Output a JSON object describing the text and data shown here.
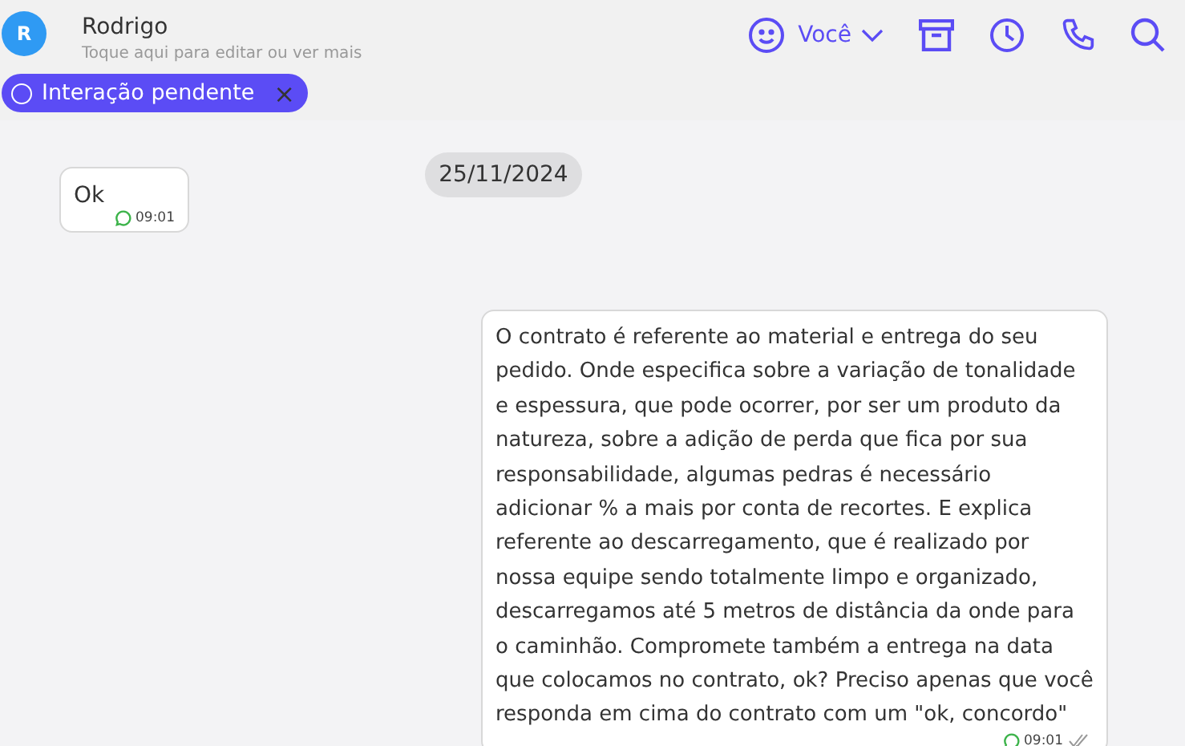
{
  "contact": {
    "avatar_letter": "R",
    "name": "Rodrigo",
    "subtitle": "Toque aqui para editar ou ver mais"
  },
  "tag": {
    "label": "Interação pendente",
    "remove": "×"
  },
  "agent": {
    "label": "Você"
  },
  "date_divider": "25/11/2024",
  "messages": [
    {
      "kind": "incoming",
      "text": "Ok",
      "time": "09:01"
    },
    {
      "kind": "outgoing",
      "text": "O contrato é referente ao material e entrega do seu pedido. Onde especifica sobre a variação de tonalidade e espessura, que pode ocorrer, por ser um produto da natureza, sobre a adição de perda que fica por sua responsabilidade, algumas pedras é necessário adicionar % a mais por conta de recortes. E explica referente ao descarregamento, que é realizado por nossa equipe sendo totalmente limpo e organizado, descarregamos até 5 metros de distância da onde para o caminhão. Compromete também a entrega na data que colocamos no contrato, ok? Preciso apenas que você responda em cima do contrato com um \"ok, concordo\"",
      "time": "09:01"
    }
  ]
}
